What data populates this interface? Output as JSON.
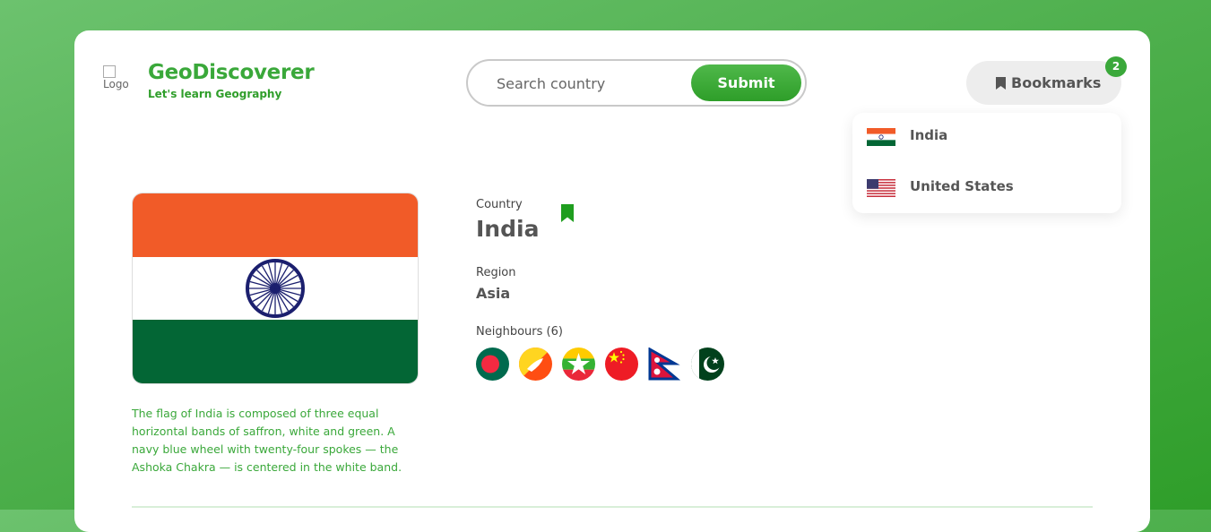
{
  "header": {
    "logo_alt": "Logo",
    "brand_title": "GeoDiscoverer",
    "brand_tagline": "Let's learn Geography"
  },
  "search": {
    "placeholder": "Search country",
    "submit_label": "Submit"
  },
  "bookmarks": {
    "label": "Bookmarks",
    "count": "2",
    "icon": "bookmark-icon",
    "items": [
      {
        "name": "India",
        "flag": "india-flag"
      },
      {
        "name": "United States",
        "flag": "us-flag"
      }
    ]
  },
  "country": {
    "country_label": "Country",
    "name": "India",
    "region_label": "Region",
    "region": "Asia",
    "neighbours_label": "Neighbours (6)",
    "neighbours": [
      "bangladesh-flag",
      "bhutan-flag",
      "myanmar-flag",
      "china-flag",
      "nepal-flag",
      "pakistan-flag"
    ],
    "description": "The flag of India is composed of three equal horizontal bands of saffron, white and green. A navy blue wheel with twenty-four spokes — the Ashoka Chakra — is centered in the white band."
  },
  "colors": {
    "brand": "#3aa83a",
    "saffron": "#f15b28",
    "india_green": "#036635",
    "chakra_navy": "#1b1f6e"
  }
}
